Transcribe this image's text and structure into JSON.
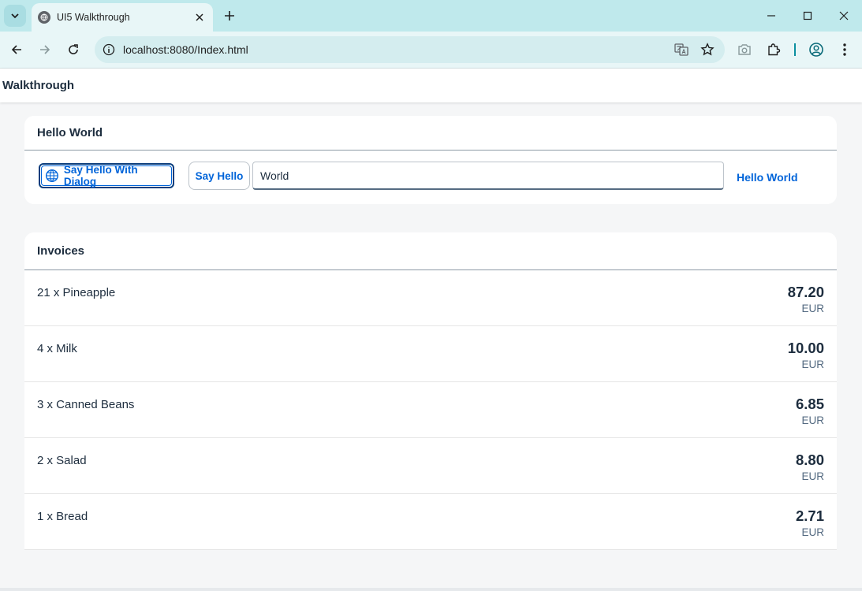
{
  "browser": {
    "tab_title": "UI5 Walkthrough",
    "url": "localhost:8080/Index.html"
  },
  "app": {
    "title": "Walkthrough"
  },
  "hello_panel": {
    "title": "Hello World",
    "dialog_button_label": "Say Hello With Dialog",
    "hello_button_label": "Say Hello",
    "name_input_value": "World",
    "hello_text": "Hello World"
  },
  "invoices": {
    "title": "Invoices",
    "items": [
      {
        "label": "21 x Pineapple",
        "amount": "87.20",
        "currency": "EUR"
      },
      {
        "label": "4 x Milk",
        "amount": "10.00",
        "currency": "EUR"
      },
      {
        "label": "3 x Canned Beans",
        "amount": "6.85",
        "currency": "EUR"
      },
      {
        "label": "2 x Salad",
        "amount": "8.80",
        "currency": "EUR"
      },
      {
        "label": "1 x Bread",
        "amount": "2.71",
        "currency": "EUR"
      }
    ]
  },
  "colors": {
    "accent": "#0064d9",
    "tabbar": "#bfe9ec",
    "toolbar": "#e8f6f7",
    "page_bg": "#f5f6f7"
  }
}
